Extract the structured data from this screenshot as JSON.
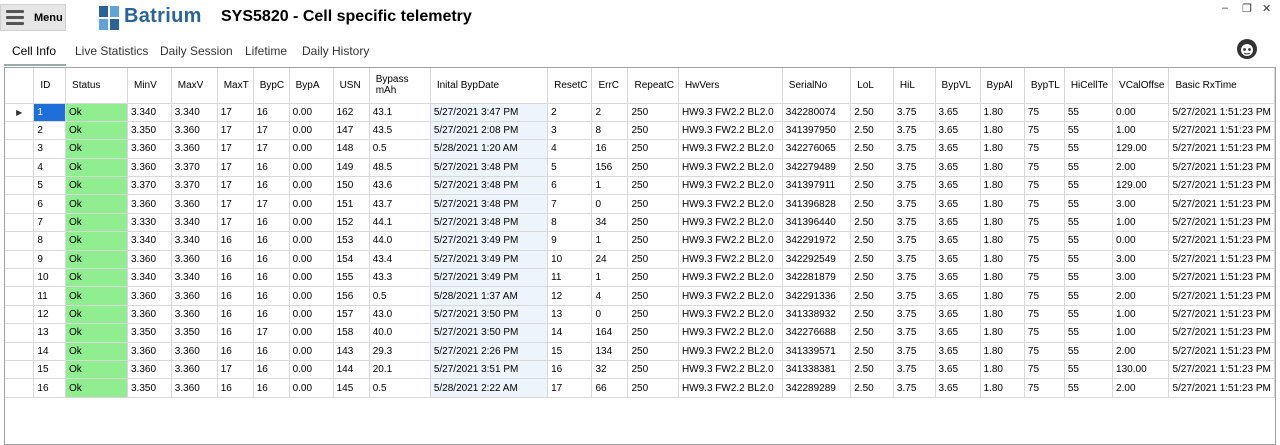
{
  "menu_label": "Menu",
  "brand": "Batrium",
  "window_title": "SYS5820 - Cell specific telemetry",
  "tabs": [
    "Cell Info",
    "Live Statistics",
    "Daily Session",
    "Lifetime",
    "Daily History"
  ],
  "columns": [
    "ID",
    "Status",
    "MinV",
    "MaxV",
    "MaxT",
    "BypC",
    "BypA",
    "USN",
    "Bypass\nmAh",
    "Inital BypDate",
    "ResetC",
    "ErrC",
    "RepeatC",
    "HwVers",
    "SerialNo",
    "LoL",
    "HiL",
    "BypVL",
    "BypAl",
    "BypTL",
    "HiCellTe",
    "VCalOffse",
    "Basic RxTime"
  ],
  "rows": [
    [
      "1",
      "Ok",
      "3.340",
      "3.340",
      "17",
      "16",
      "0.00",
      "162",
      "43.1",
      "5/27/2021 3:47 PM",
      "2",
      "2",
      "250",
      "HW9.3 FW2.2 BL2.0",
      "342280074",
      "2.50",
      "3.75",
      "3.65",
      "1.80",
      "75",
      "55",
      "0.00",
      "5/27/2021 1:51:23 PM"
    ],
    [
      "2",
      "Ok",
      "3.350",
      "3.360",
      "17",
      "17",
      "0.00",
      "147",
      "43.5",
      "5/27/2021 2:08 PM",
      "3",
      "8",
      "250",
      "HW9.3 FW2.2 BL2.0",
      "341397950",
      "2.50",
      "3.75",
      "3.65",
      "1.80",
      "75",
      "55",
      "1.00",
      "5/27/2021 1:51:23 PM"
    ],
    [
      "3",
      "Ok",
      "3.360",
      "3.360",
      "17",
      "17",
      "0.00",
      "148",
      "0.5",
      "5/28/2021 1:20 AM",
      "4",
      "16",
      "250",
      "HW9.3 FW2.2 BL2.0",
      "342276065",
      "2.50",
      "3.75",
      "3.65",
      "1.80",
      "75",
      "55",
      "129.00",
      "5/27/2021 1:51:23 PM"
    ],
    [
      "4",
      "Ok",
      "3.360",
      "3.370",
      "17",
      "16",
      "0.00",
      "149",
      "48.5",
      "5/27/2021 3:48 PM",
      "5",
      "156",
      "250",
      "HW9.3 FW2.2 BL2.0",
      "342279489",
      "2.50",
      "3.75",
      "3.65",
      "1.80",
      "75",
      "55",
      "2.00",
      "5/27/2021 1:51:23 PM"
    ],
    [
      "5",
      "Ok",
      "3.370",
      "3.370",
      "17",
      "16",
      "0.00",
      "150",
      "43.6",
      "5/27/2021 3:48 PM",
      "6",
      "1",
      "250",
      "HW9.3 FW2.2 BL2.0",
      "341397911",
      "2.50",
      "3.75",
      "3.65",
      "1.80",
      "75",
      "55",
      "129.00",
      "5/27/2021 1:51:23 PM"
    ],
    [
      "6",
      "Ok",
      "3.360",
      "3.360",
      "17",
      "17",
      "0.00",
      "151",
      "43.7",
      "5/27/2021 3:48 PM",
      "7",
      "0",
      "250",
      "HW9.3 FW2.2 BL2.0",
      "341396828",
      "2.50",
      "3.75",
      "3.65",
      "1.80",
      "75",
      "55",
      "3.00",
      "5/27/2021 1:51:23 PM"
    ],
    [
      "7",
      "Ok",
      "3.330",
      "3.340",
      "17",
      "16",
      "0.00",
      "152",
      "44.1",
      "5/27/2021 3:48 PM",
      "8",
      "34",
      "250",
      "HW9.3 FW2.2 BL2.0",
      "341396440",
      "2.50",
      "3.75",
      "3.65",
      "1.80",
      "75",
      "55",
      "1.00",
      "5/27/2021 1:51:23 PM"
    ],
    [
      "8",
      "Ok",
      "3.340",
      "3.340",
      "16",
      "16",
      "0.00",
      "153",
      "44.0",
      "5/27/2021 3:49 PM",
      "9",
      "1",
      "250",
      "HW9.3 FW2.2 BL2.0",
      "342291972",
      "2.50",
      "3.75",
      "3.65",
      "1.80",
      "75",
      "55",
      "0.00",
      "5/27/2021 1:51:23 PM"
    ],
    [
      "9",
      "Ok",
      "3.360",
      "3.360",
      "16",
      "16",
      "0.00",
      "154",
      "43.4",
      "5/27/2021 3:49 PM",
      "10",
      "24",
      "250",
      "HW9.3 FW2.2 BL2.0",
      "342292549",
      "2.50",
      "3.75",
      "3.65",
      "1.80",
      "75",
      "55",
      "3.00",
      "5/27/2021 1:51:23 PM"
    ],
    [
      "10",
      "Ok",
      "3.340",
      "3.340",
      "16",
      "16",
      "0.00",
      "155",
      "43.3",
      "5/27/2021 3:49 PM",
      "11",
      "1",
      "250",
      "HW9.3 FW2.2 BL2.0",
      "342281879",
      "2.50",
      "3.75",
      "3.65",
      "1.80",
      "75",
      "55",
      "3.00",
      "5/27/2021 1:51:23 PM"
    ],
    [
      "11",
      "Ok",
      "3.360",
      "3.360",
      "16",
      "16",
      "0.00",
      "156",
      "0.5",
      "5/28/2021 1:37 AM",
      "12",
      "4",
      "250",
      "HW9.3 FW2.2 BL2.0",
      "342291336",
      "2.50",
      "3.75",
      "3.65",
      "1.80",
      "75",
      "55",
      "2.00",
      "5/27/2021 1:51:23 PM"
    ],
    [
      "12",
      "Ok",
      "3.360",
      "3.360",
      "16",
      "16",
      "0.00",
      "157",
      "43.0",
      "5/27/2021 3:50 PM",
      "13",
      "0",
      "250",
      "HW9.3 FW2.2 BL2.0",
      "341338932",
      "2.50",
      "3.75",
      "3.65",
      "1.80",
      "75",
      "55",
      "1.00",
      "5/27/2021 1:51:23 PM"
    ],
    [
      "13",
      "Ok",
      "3.350",
      "3.350",
      "16",
      "17",
      "0.00",
      "158",
      "40.0",
      "5/27/2021 3:50 PM",
      "14",
      "164",
      "250",
      "HW9.3 FW2.2 BL2.0",
      "342276688",
      "2.50",
      "3.75",
      "3.65",
      "1.80",
      "75",
      "55",
      "1.00",
      "5/27/2021 1:51:23 PM"
    ],
    [
      "14",
      "Ok",
      "3.360",
      "3.360",
      "16",
      "16",
      "0.00",
      "143",
      "29.3",
      "5/27/2021 2:26 PM",
      "15",
      "134",
      "250",
      "HW9.3 FW2.2 BL2.0",
      "341339571",
      "2.50",
      "3.75",
      "3.65",
      "1.80",
      "75",
      "55",
      "2.00",
      "5/27/2021 1:51:23 PM"
    ],
    [
      "15",
      "Ok",
      "3.360",
      "3.360",
      "17",
      "16",
      "0.00",
      "144",
      "20.1",
      "5/27/2021 3:51 PM",
      "16",
      "32",
      "250",
      "HW9.3 FW2.2 BL2.0",
      "341338381",
      "2.50",
      "3.75",
      "3.65",
      "1.80",
      "75",
      "55",
      "130.00",
      "5/27/2021 1:51:23 PM"
    ],
    [
      "16",
      "Ok",
      "3.350",
      "3.360",
      "16",
      "16",
      "0.00",
      "145",
      "0.5",
      "5/28/2021 2:22 AM",
      "17",
      "66",
      "250",
      "HW9.3 FW2.2 BL2.0",
      "342289289",
      "2.50",
      "3.75",
      "3.65",
      "1.80",
      "75",
      "55",
      "2.00",
      "5/27/2021 1:51:23 PM"
    ]
  ],
  "colors": {
    "status_ok": "#90ee90",
    "date_cell": "#eef4fb",
    "selected": "#1e6fd9",
    "brand": "#2a6496"
  },
  "icons": {
    "menu": "hamburger-icon",
    "logo": "batrium-logo-icon",
    "avatar": "user-avatar-icon",
    "row_pointer": "current-row-arrow-icon"
  }
}
